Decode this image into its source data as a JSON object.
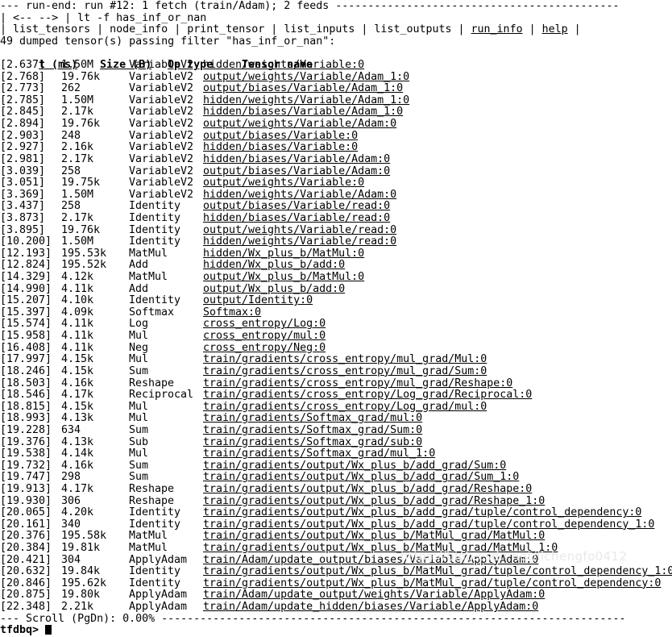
{
  "terminal": {
    "app_prompt": "tfdbq>",
    "cursor": "block-cursor"
  },
  "run_header": {
    "text": "--- run-end: run #12: 1 fetch (train/Adam); 2 feeds --------------------------------------------",
    "label": "run-end: run #12: 1 fetch (train/Adam); 2 feeds"
  },
  "nav": {
    "back_label": "<--",
    "forward_label": "-->",
    "command_line": "lt -f has_inf_or_nan",
    "prefix": "| ",
    "sep": " | ",
    "menu_items": [
      {
        "label": "list_tensors",
        "underlined": false
      },
      {
        "label": "node_info",
        "underlined": false
      },
      {
        "label": "print_tensor",
        "underlined": false
      },
      {
        "label": "list_inputs",
        "underlined": false
      },
      {
        "label": "list_outputs",
        "underlined": false
      },
      {
        "label": "run_info",
        "underlined": true
      },
      {
        "label": "help",
        "underlined": true
      }
    ]
  },
  "summary": {
    "text": "49 dumped tensor(s) passing filter \"has_inf_or_nan\":"
  },
  "table": {
    "columns": [
      {
        "key": "t",
        "label": "t (ms)"
      },
      {
        "key": "size",
        "label": "Size (B)"
      },
      {
        "key": "op",
        "label": "Op type"
      },
      {
        "key": "name",
        "label": "Tensor name"
      }
    ],
    "rows": [
      {
        "t": "[2.637]",
        "size": "1.50M",
        "op": "VariableV2",
        "name": "hidden/weights/Variable:0"
      },
      {
        "t": "[2.768]",
        "size": "19.76k",
        "op": "VariableV2",
        "name": "output/weights/Variable/Adam_1:0"
      },
      {
        "t": "[2.773]",
        "size": "262",
        "op": "VariableV2",
        "name": "output/biases/Variable/Adam_1:0"
      },
      {
        "t": "[2.785]",
        "size": "1.50M",
        "op": "VariableV2",
        "name": "hidden/weights/Variable/Adam_1:0"
      },
      {
        "t": "[2.845]",
        "size": "2.17k",
        "op": "VariableV2",
        "name": "hidden/biases/Variable/Adam_1:0"
      },
      {
        "t": "[2.894]",
        "size": "19.76k",
        "op": "VariableV2",
        "name": "output/weights/Variable/Adam:0"
      },
      {
        "t": "[2.903]",
        "size": "248",
        "op": "VariableV2",
        "name": "output/biases/Variable:0"
      },
      {
        "t": "[2.927]",
        "size": "2.16k",
        "op": "VariableV2",
        "name": "hidden/biases/Variable:0"
      },
      {
        "t": "[2.981]",
        "size": "2.17k",
        "op": "VariableV2",
        "name": "hidden/biases/Variable/Adam:0"
      },
      {
        "t": "[3.039]",
        "size": "258",
        "op": "VariableV2",
        "name": "output/biases/Variable/Adam:0"
      },
      {
        "t": "[3.051]",
        "size": "19.75k",
        "op": "VariableV2",
        "name": "output/weights/Variable:0"
      },
      {
        "t": "[3.369]",
        "size": "1.50M",
        "op": "VariableV2",
        "name": "hidden/weights/Variable/Adam:0"
      },
      {
        "t": "[3.437]",
        "size": "258",
        "op": "Identity",
        "name": "output/biases/Variable/read:0"
      },
      {
        "t": "[3.873]",
        "size": "2.17k",
        "op": "Identity",
        "name": "hidden/biases/Variable/read:0"
      },
      {
        "t": "[3.895]",
        "size": "19.76k",
        "op": "Identity",
        "name": "output/weights/Variable/read:0"
      },
      {
        "t": "[10.200]",
        "size": "1.50M",
        "op": "Identity",
        "name": "hidden/weights/Variable/read:0"
      },
      {
        "t": "[12.193]",
        "size": "195.53k",
        "op": "MatMul",
        "name": "hidden/Wx_plus_b/MatMul:0"
      },
      {
        "t": "[12.824]",
        "size": "195.52k",
        "op": "Add",
        "name": "hidden/Wx_plus_b/add:0"
      },
      {
        "t": "[14.329]",
        "size": "4.12k",
        "op": "MatMul",
        "name": "output/Wx_plus_b/MatMul:0"
      },
      {
        "t": "[14.990]",
        "size": "4.11k",
        "op": "Add",
        "name": "output/Wx_plus_b/add:0"
      },
      {
        "t": "[15.207]",
        "size": "4.10k",
        "op": "Identity",
        "name": "output/Identity:0"
      },
      {
        "t": "[15.397]",
        "size": "4.09k",
        "op": "Softmax",
        "name": "Softmax:0"
      },
      {
        "t": "[15.574]",
        "size": "4.11k",
        "op": "Log",
        "name": "cross_entropy/Log:0"
      },
      {
        "t": "[15.958]",
        "size": "4.11k",
        "op": "Mul",
        "name": "cross_entropy/mul:0"
      },
      {
        "t": "[16.408]",
        "size": "4.11k",
        "op": "Neg",
        "name": "cross_entropy/Neg:0"
      },
      {
        "t": "[17.997]",
        "size": "4.15k",
        "op": "Mul",
        "name": "train/gradients/cross_entropy/mul_grad/Mul:0"
      },
      {
        "t": "[18.246]",
        "size": "4.15k",
        "op": "Sum",
        "name": "train/gradients/cross_entropy/mul_grad/Sum:0"
      },
      {
        "t": "[18.503]",
        "size": "4.16k",
        "op": "Reshape",
        "name": "train/gradients/cross_entropy/mul_grad/Reshape:0"
      },
      {
        "t": "[18.546]",
        "size": "4.17k",
        "op": "Reciprocal",
        "name": "train/gradients/cross_entropy/Log_grad/Reciprocal:0"
      },
      {
        "t": "[18.815]",
        "size": "4.15k",
        "op": "Mul",
        "name": "train/gradients/cross_entropy/Log_grad/mul:0"
      },
      {
        "t": "[18.993]",
        "size": "4.13k",
        "op": "Mul",
        "name": "train/gradients/Softmax_grad/mul:0"
      },
      {
        "t": "[19.228]",
        "size": "634",
        "op": "Sum",
        "name": "train/gradients/Softmax_grad/Sum:0"
      },
      {
        "t": "[19.376]",
        "size": "4.13k",
        "op": "Sub",
        "name": "train/gradients/Softmax_grad/sub:0"
      },
      {
        "t": "[19.538]",
        "size": "4.14k",
        "op": "Mul",
        "name": "train/gradients/Softmax_grad/mul_1:0"
      },
      {
        "t": "[19.732]",
        "size": "4.16k",
        "op": "Sum",
        "name": "train/gradients/output/Wx_plus_b/add_grad/Sum:0"
      },
      {
        "t": "[19.747]",
        "size": "298",
        "op": "Sum",
        "name": "train/gradients/output/Wx_plus_b/add_grad/Sum_1:0"
      },
      {
        "t": "[19.913]",
        "size": "4.17k",
        "op": "Reshape",
        "name": "train/gradients/output/Wx_plus_b/add_grad/Reshape:0"
      },
      {
        "t": "[19.930]",
        "size": "306",
        "op": "Reshape",
        "name": "train/gradients/output/Wx_plus_b/add_grad/Reshape_1:0"
      },
      {
        "t": "[20.065]",
        "size": "4.20k",
        "op": "Identity",
        "name": "train/gradients/output/Wx_plus_b/add_grad/tuple/control_dependency:0"
      },
      {
        "t": "[20.161]",
        "size": "340",
        "op": "Identity",
        "name": "train/gradients/output/Wx_plus_b/add_grad/tuple/control_dependency_1:0"
      },
      {
        "t": "[20.376]",
        "size": "195.58k",
        "op": "MatMul",
        "name": "train/gradients/output/Wx_plus_b/MatMul_grad/MatMul:0"
      },
      {
        "t": "[20.384]",
        "size": "19.81k",
        "op": "MatMul",
        "name": "train/gradients/output/Wx_plus_b/MatMul_grad/MatMul_1:0"
      },
      {
        "t": "[20.421]",
        "size": "304",
        "op": "ApplyAdam",
        "name": "train/Adam/update_output/biases/Variable/ApplyAdam:0"
      },
      {
        "t": "[20.632]",
        "size": "19.84k",
        "op": "Identity",
        "name": "train/gradients/output/Wx_plus_b/MatMul_grad/tuple/control_dependency_1:0"
      },
      {
        "t": "[20.846]",
        "size": "195.62k",
        "op": "Identity",
        "name": "train/gradients/output/Wx_plus_b/MatMul_grad/tuple/control_dependency:0"
      },
      {
        "t": "[20.875]",
        "size": "19.80k",
        "op": "ApplyAdam",
        "name": "train/Adam/update_output/weights/Variable/ApplyAdam:0"
      },
      {
        "t": "[22.348]",
        "size": "2.21k",
        "op": "ApplyAdam",
        "name": "train/Adam/update_hidden/biases/Variable/ApplyAdam:0"
      }
    ]
  },
  "scrollbar": {
    "text": "--- Scroll (PgDn): 0.00% ------------------------------------------------------------------------",
    "label": "Scroll (PgDn): 0.00%",
    "percent": "0.00%"
  },
  "watermark": {
    "text": "https://blog.csdn.net/lichengfo0412"
  }
}
